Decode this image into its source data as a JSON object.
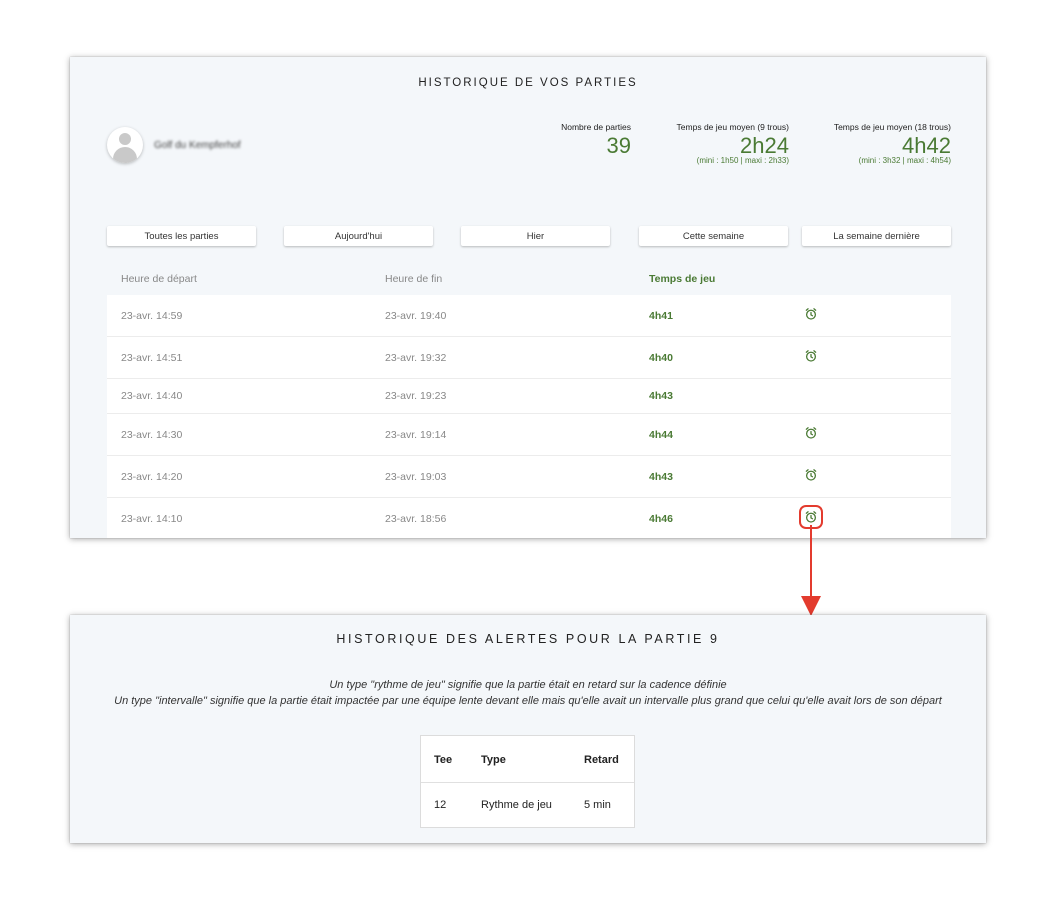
{
  "games_panel": {
    "title": "HISTORIQUE DE VOS PARTIES",
    "user_name": "Golf du Kempferhof",
    "stats": {
      "count_label": "Nombre de parties",
      "count_value": "39",
      "nine_label": "Temps de jeu moyen (9 trous)",
      "nine_value": "2h24",
      "nine_range": "(mini : 1h50 | maxi : 2h33)",
      "eighteen_label": "Temps de jeu moyen (18 trous)",
      "eighteen_value": "4h42",
      "eighteen_range": "(mini : 3h32 | maxi : 4h54)"
    },
    "filters": [
      "Toutes les parties",
      "Aujourd'hui",
      "Hier",
      "Cette semaine",
      "La semaine dernière"
    ],
    "columns": {
      "start": "Heure de départ",
      "end": "Heure de fin",
      "duration": "Temps de jeu"
    },
    "rows": [
      {
        "start": "23-avr. 14:59",
        "end": "23-avr. 19:40",
        "duration": "4h41",
        "alert": true
      },
      {
        "start": "23-avr. 14:51",
        "end": "23-avr. 19:32",
        "duration": "4h40",
        "alert": true
      },
      {
        "start": "23-avr. 14:40",
        "end": "23-avr. 19:23",
        "duration": "4h43",
        "alert": false
      },
      {
        "start": "23-avr. 14:30",
        "end": "23-avr. 19:14",
        "duration": "4h44",
        "alert": true
      },
      {
        "start": "23-avr. 14:20",
        "end": "23-avr. 19:03",
        "duration": "4h43",
        "alert": true
      },
      {
        "start": "23-avr. 14:10",
        "end": "23-avr. 18:56",
        "duration": "4h46",
        "alert": true
      }
    ],
    "icon": "alarm-clock-icon"
  },
  "alerts_panel": {
    "title": "HISTORIQUE DES ALERTES POUR LA PARTIE 9",
    "desc_line1": "Un type \"rythme de jeu\" signifie que la partie était en retard sur la cadence définie",
    "desc_line2": "Un type \"intervalle\" signifie que la partie était impactée par une équipe lente devant elle mais qu'elle avait un intervalle plus grand que celui qu'elle avait lors de son départ",
    "table": {
      "headers": {
        "tee": "Tee",
        "type": "Type",
        "delay": "Retard"
      },
      "row": {
        "tee": "12",
        "type": "Rythme de jeu",
        "delay": "5 min"
      }
    }
  },
  "colors": {
    "accent_green": "#4a7a34",
    "highlight_red": "#e33b2e",
    "panel_bg": "#f4f7fa"
  }
}
